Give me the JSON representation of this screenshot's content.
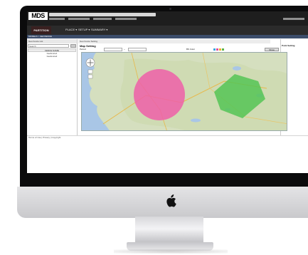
{
  "app": {
    "logo": "MDS",
    "brand": "PARTITION",
    "menu": [
      "PLACE ▾",
      "SETUP ▾",
      "SUMMARY ▾"
    ],
    "breadcrumb": "MODELS > GEOFENCE"
  },
  "left_panel": {
    "title": "Geo Fence List",
    "search_placeholder": "Search",
    "column_header": "FENCE NAME",
    "rows": [
      "Geofence1",
      "Geofence2"
    ]
  },
  "right_panel": {
    "title": "Geo Fence Setting",
    "map_setting_label": "Map Setting",
    "controls": [
      "Period",
      "~",
      "BS Color"
    ],
    "show_button": "Show",
    "point_setting_label": "Point Setting",
    "colors": [
      "#3aa6e0",
      "#e14e9a",
      "#f0b42a",
      "#5ab54b"
    ]
  },
  "footer": {
    "left": "Terms of Use | Privacy | Copyright"
  },
  "map": {
    "circle_color": "#ee5fa8",
    "polygon_color": "#55c455"
  }
}
